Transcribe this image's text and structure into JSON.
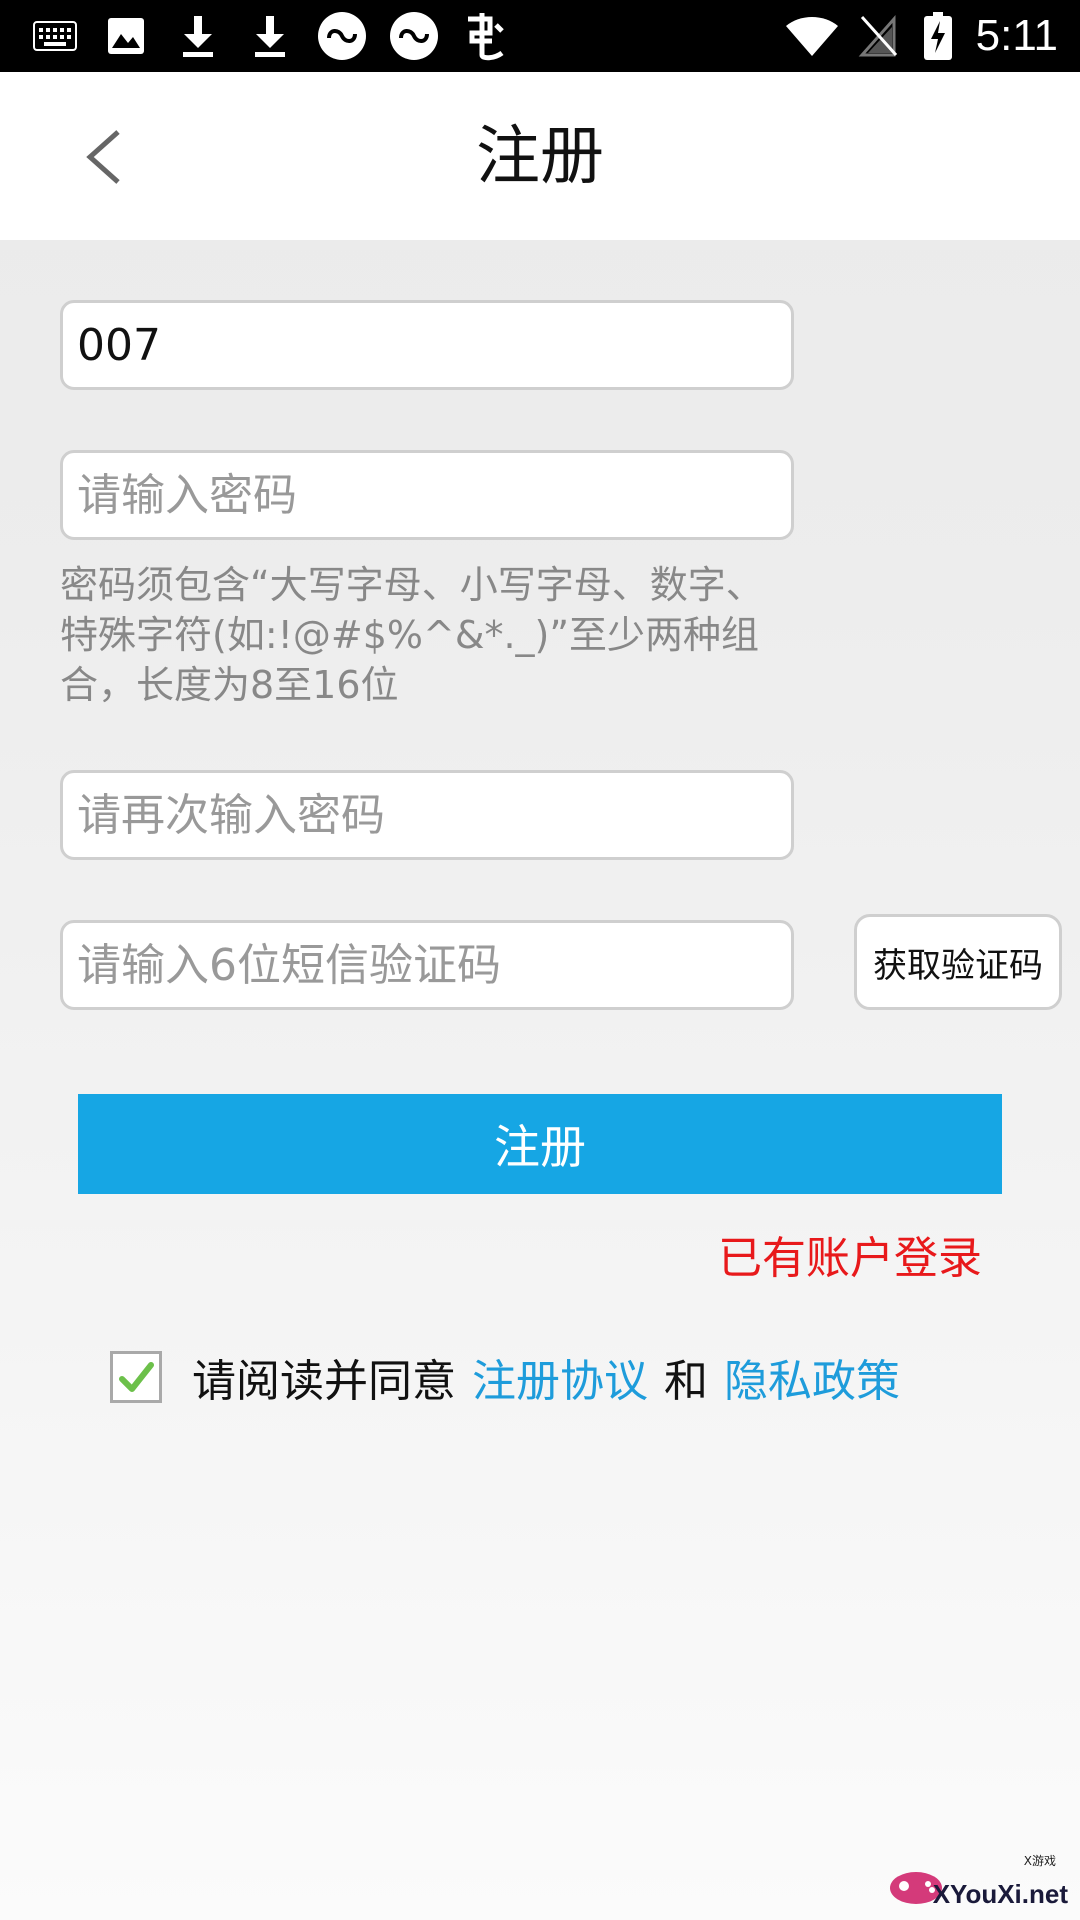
{
  "status_bar": {
    "time": "5:11",
    "left_icons": [
      "keyboard-icon",
      "image-icon",
      "download-icon",
      "download-icon",
      "infinity-app-icon",
      "infinity-app-icon",
      "bug-icon"
    ],
    "right_icons": [
      "wifi-icon",
      "no-signal-icon",
      "battery-charging-icon"
    ]
  },
  "header": {
    "title": "注册",
    "back_icon": "chevron-left-icon"
  },
  "form": {
    "username_value": "007",
    "password_placeholder": "请输入密码",
    "password_hint": "密码须包含“大写字母、小写字母、数字、特殊字符(如:!@#$%^&*._)”至少两种组合，长度为8至16位",
    "confirm_placeholder": "请再次输入密码",
    "sms_placeholder": "请输入6位短信验证码",
    "sms_button": "获取验证码",
    "register_button": "注册",
    "login_link": "已有账户登录"
  },
  "agreement": {
    "checked": true,
    "prefix": "请阅读并同意",
    "terms_link": "注册协议",
    "conjunction": "和",
    "privacy_link": "隐私政策"
  },
  "colors": {
    "primary": "#16a6e4",
    "link": "#1e9cdb",
    "login_link": "#e8191b",
    "check": "#6cc04a"
  },
  "watermark": {
    "text": "XYouXi.net",
    "small": "X游戏"
  }
}
